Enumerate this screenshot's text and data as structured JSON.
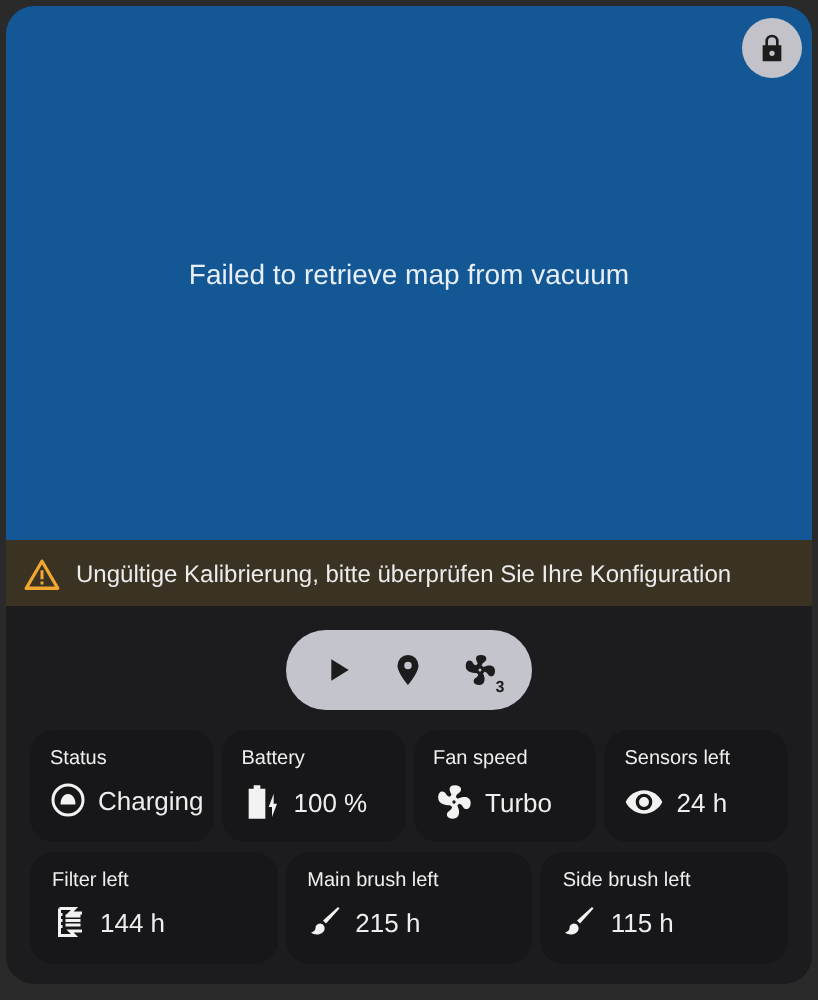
{
  "map": {
    "message": "Failed to retrieve map from vacuum",
    "locked": true
  },
  "warning": {
    "text": "Ungültige Kalibrierung, bitte überprüfen Sie Ihre Konfiguration"
  },
  "controls": [
    {
      "kind": "start"
    },
    {
      "kind": "locate"
    },
    {
      "kind": "fan",
      "badge": "3"
    }
  ],
  "stats": [
    {
      "label": "Status",
      "value": "Charging",
      "kind": "status"
    },
    {
      "label": "Battery",
      "value": "100 %",
      "kind": "battery"
    },
    {
      "label": "Fan speed",
      "value": "Turbo",
      "kind": "fan"
    },
    {
      "label": "Sensors left",
      "value": "24 h",
      "kind": "sensors"
    }
  ],
  "consumables": [
    {
      "label": "Filter left",
      "value": "144 h",
      "kind": "filter"
    },
    {
      "label": "Main brush left",
      "value": "215 h",
      "kind": "brush"
    },
    {
      "label": "Side brush left",
      "value": "115 h",
      "kind": "brush"
    }
  ]
}
